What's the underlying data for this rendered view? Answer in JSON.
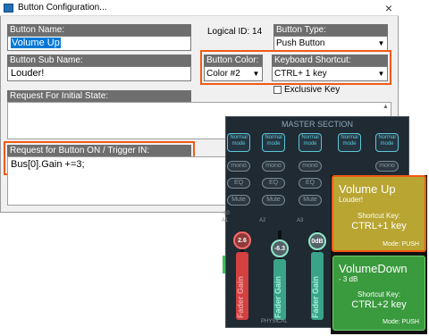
{
  "window": {
    "title": "Button Configuration...",
    "close": "×"
  },
  "button_name": {
    "label": "Button Name:",
    "value": "Volume Up"
  },
  "logical_id": "Logical ID: 14",
  "button_type": {
    "label": "Button Type:",
    "value": "Push Button"
  },
  "button_sub_name": {
    "label": "Button Sub Name:",
    "value": "Louder!"
  },
  "button_color": {
    "label": "Button Color:",
    "value": "Color #2"
  },
  "keyboard_shortcut": {
    "label": "Keyboard Shortcut:",
    "value": "CTRL+ 1 key"
  },
  "exclusive_key": {
    "label": "Exclusive Key",
    "checked": false
  },
  "request_initial": {
    "label": "Request For Initial State:",
    "value": ""
  },
  "request_on": {
    "label": "Request for Button ON / Trigger IN:",
    "value": "Bus[0].Gain +=3;"
  },
  "mixer": {
    "title": "MASTER SECTION",
    "mode_label": "Normal mode",
    "mono": "mono",
    "eq": "EQ",
    "mute": "Mute",
    "fader_label": "Fader Gain",
    "footer": "PHYSICAL",
    "strips": [
      {
        "id": "A1",
        "gain": "2.6",
        "scale": "-10"
      },
      {
        "id": "A2",
        "gain": "-6.3"
      },
      {
        "id": "A3",
        "gain": "0dB"
      }
    ]
  },
  "preview_buttons": [
    {
      "title": "Volume Up",
      "sub": "Louder!",
      "shortcut_label": "Shortcut Key:",
      "shortcut": "CTRL+1 key",
      "mode": "Mode: PUSH",
      "color": "#b8a532"
    },
    {
      "title": "VolumeDown",
      "sub": "- 3 dB",
      "shortcut_label": "Shortcut Key:",
      "shortcut": "CTRL+2 key",
      "mode": "Mode: PUSH",
      "color": "#3a9a3e"
    }
  ],
  "accent_color": "#f05a14"
}
